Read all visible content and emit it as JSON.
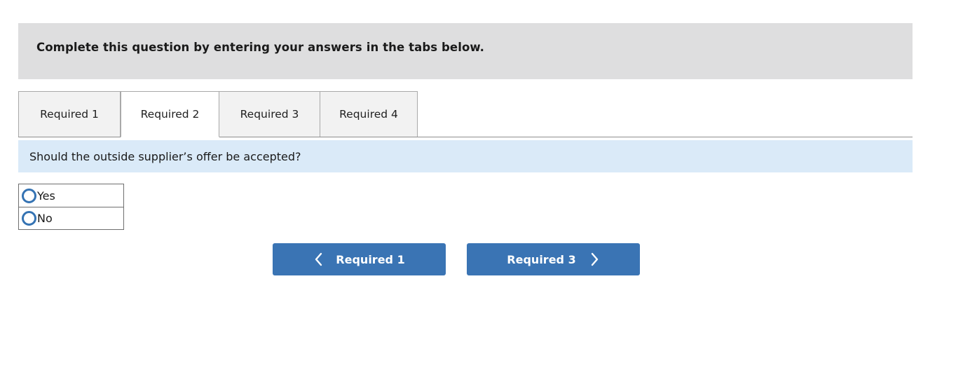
{
  "banner": {
    "instruction": "Complete this question by entering your answers in the tabs below."
  },
  "tabs": {
    "active_index": 1,
    "items": [
      {
        "label": "Required 1",
        "active": false
      },
      {
        "label": "Required 2",
        "active": true
      },
      {
        "label": "Required 3",
        "active": false
      },
      {
        "label": "Required 4",
        "active": false
      }
    ]
  },
  "question": {
    "text": "Should the outside supplier’s offer be accepted?"
  },
  "answers": {
    "selected": null,
    "options": [
      {
        "label": "Yes",
        "value": "yes",
        "checked": false
      },
      {
        "label": "No",
        "value": "no",
        "checked": false
      }
    ]
  },
  "navigation": {
    "prev": {
      "label": "Required 1",
      "icon": "chevron-left-icon"
    },
    "next": {
      "label": "Required 3",
      "icon": "chevron-right-icon"
    }
  },
  "colors": {
    "banner_gray": "#dededf",
    "question_blue": "#daeaf8",
    "button_blue": "#3a74b4",
    "radio_blue": "#3573b3",
    "tab_inactive": "#f2f2f2",
    "tab_active": "#ffffff",
    "border_gray": "#a9a9a9"
  }
}
